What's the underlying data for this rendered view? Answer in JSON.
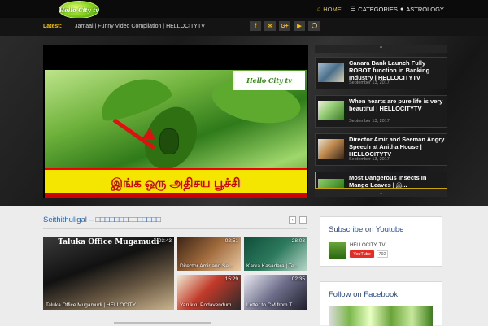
{
  "header": {
    "logo_text": "Hello City tv",
    "nav": [
      {
        "label": "HOME",
        "icon": "home-icon"
      },
      {
        "label": "CATEGORIES",
        "icon": "list-icon"
      },
      {
        "label": "ASTROLOGY",
        "icon": "circle-icon"
      }
    ],
    "accent_color": "#f2c112"
  },
  "ticker": {
    "label": "Latest:",
    "text": "Jamaai | Funny Video Compilation | HELLOCITYTV"
  },
  "social": [
    "f",
    "✉",
    "G+",
    "▶",
    "🔍"
  ],
  "hero": {
    "video_logo": "Hello City tv",
    "video_caption": "இங்க ஒரு அதிசய பூச்சி",
    "list": [
      {
        "title": "Canara Bank Launch Fully ROBOT function in Banking Industry | HELLOCITYTV",
        "date": "September 13, 2017"
      },
      {
        "title": "When hearts are pure life is very beautiful | HELLOCITYTV",
        "date": "September 13, 2017"
      },
      {
        "title": "Director Amir and Seeman Angry Speech at Anitha House | HELLOCITYTV",
        "date": "September 13, 2017"
      },
      {
        "title": "Most Dangerous Insects In Mango Leaves | இ...",
        "date": ""
      }
    ]
  },
  "section": {
    "title": "Seithithuligal – □□□□□□□□□□□□□□",
    "prev": "‹",
    "next": "›",
    "tiles": [
      {
        "caption": "Taluka Office Mugamudi | HELLOCITY",
        "overlay": "Taluka Office Mugamudi",
        "duration": "03:43"
      },
      {
        "caption": "Director Amir and Se...",
        "duration": "02:51"
      },
      {
        "caption": "Karka Kasadara | Te...",
        "duration": "28:03"
      },
      {
        "caption": "Yarukku Podavendum",
        "duration": "15:29"
      },
      {
        "caption": "Letter to CM from T...",
        "duration": "02:35"
      }
    ]
  },
  "widgets": {
    "youtube": {
      "title": "Subscribe on Youtube",
      "channel": "HELLOCITY. TV",
      "button": "YouTube",
      "count": "792"
    },
    "facebook": {
      "title": "Follow on Facebook"
    }
  }
}
